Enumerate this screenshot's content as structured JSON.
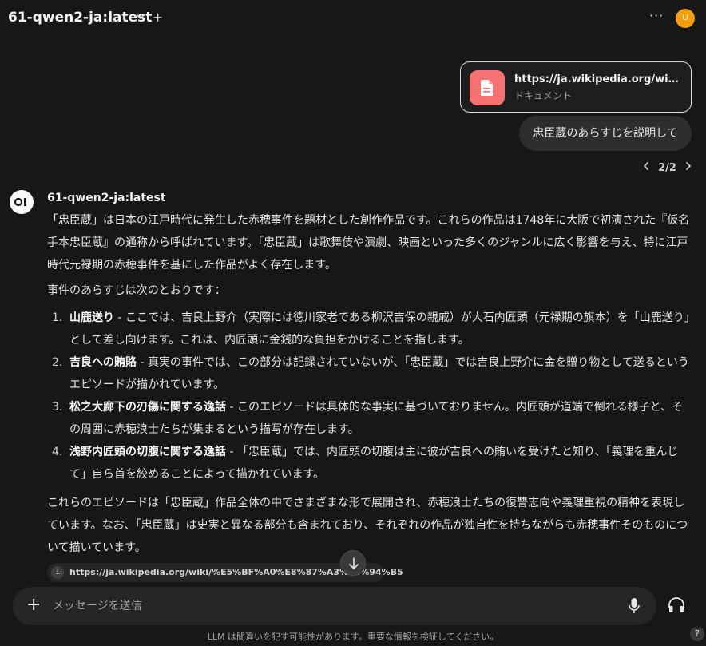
{
  "header": {
    "model_name": "61-qwen2-ja:latest",
    "more_label": "···",
    "avatar_initial": "U"
  },
  "attachment": {
    "url": "https://ja.wikipedia.org/wiki/%E5%BF%A0%E8%87%A3%E8%94%B5",
    "type": "ドキュメント"
  },
  "user_message": "忠臣蔵のあらすじを説明して",
  "pager": {
    "label": "2/2"
  },
  "assistant": {
    "name": "61-qwen2-ja:latest",
    "intro": "「忠臣蔵」は日本の江戸時代に発生した赤穂事件を題材とした創作作品です。これらの作品は1748年に大阪で初演された『仮名手本忠臣蔵』の通称から呼ばれています。「忠臣蔵」は歌舞伎や演劇、映画といった多くのジャンルに広く影響を与え、特に江戸時代元禄期の赤穂事件を基にした作品がよく存在します。",
    "intro2": "事件のあらすじは次のとおりです：",
    "items": [
      {
        "num": "1.",
        "title": "山鹿送り",
        "text": " - ここでは、吉良上野介（実際には徳川家老である柳沢吉保の親戚）が大石内匠頭（元禄期の旗本）を「山鹿送り」として差し向けます。これは、内匠頭に金銭的な負担をかけることを指します。"
      },
      {
        "num": "2.",
        "title": "吉良への賄賂",
        "text": " - 真実の事件では、この部分は記録されていないが、「忠臣蔵」では吉良上野介に金を贈り物として送るというエピソードが描かれています。"
      },
      {
        "num": "3.",
        "title": "松之大廊下の刃傷に関する逸話",
        "text": " - このエピソードは具体的な事実に基づいておりません。内匠頭が道端で倒れる様子と、その周囲に赤穂浪士たちが集まるという描写が存在します。"
      },
      {
        "num": "4.",
        "title": "浅野内匠頭の切腹に関する逸話",
        "text": " - 「忠臣蔵」では、内匠頭の切腹は主に彼が吉良への賄いを受けたと知り、「義理を重んじて」自ら首を絞めることによって描かれています。"
      }
    ],
    "outro": "これらのエピソードは「忠臣蔵」作品全体の中でさまざまな形で展開され、赤穂浪士たちの復讐志向や義理重視の精神を表現しています。なお、「忠臣蔵」は史実と異なる部分も含まれており、それぞれの作品が独自性を持ちながらも赤穂事件そのものについて描いています。"
  },
  "source": {
    "num": "1",
    "url": "https://ja.wikipedia.org/wiki/%E5%BF%A0%E8%87%A3%E8%94%B5"
  },
  "composer": {
    "placeholder": "メッセージを送信"
  },
  "footer": {
    "disclaimer": "LLM は間違いを犯す可能性があります。重要な情報を検証してください。",
    "help": "?"
  },
  "colors": {
    "background": "#171717",
    "avatar": "#f59e0b",
    "file_icon": "#f87171"
  }
}
